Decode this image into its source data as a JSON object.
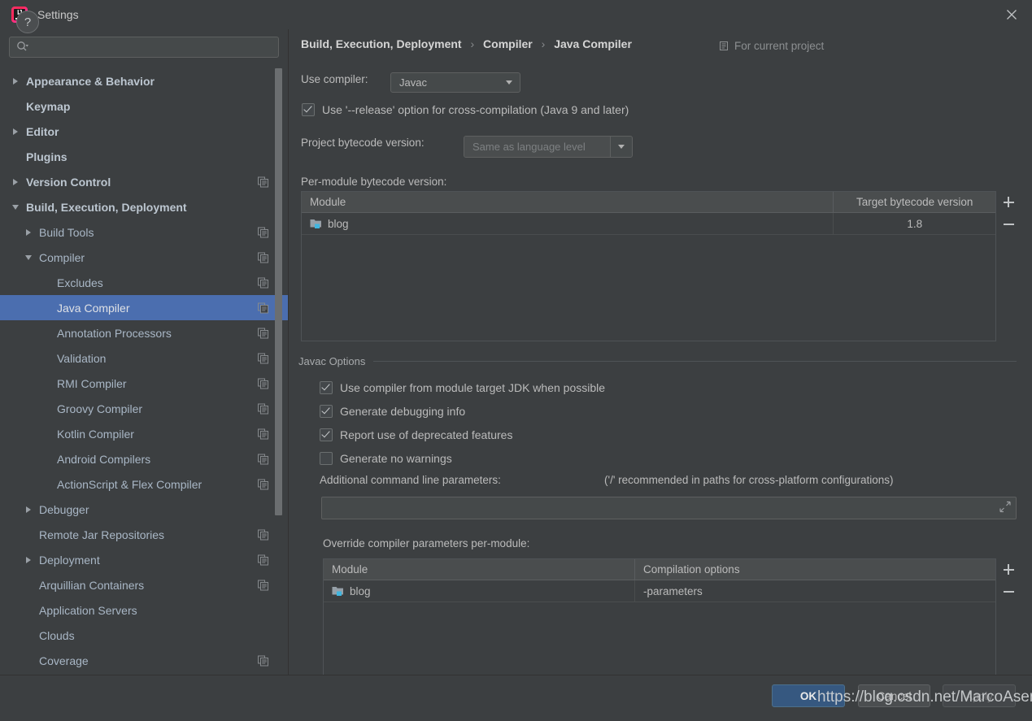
{
  "window": {
    "title": "Settings",
    "logo_icon": "intellij-idea-logo",
    "close_icon": "close-icon"
  },
  "search": {
    "placeholder": "",
    "value": "",
    "icon": "search-icon"
  },
  "sidebar": {
    "items": [
      {
        "label": "Appearance & Behavior",
        "arrow": "right",
        "indent": 0,
        "bold": true,
        "copy": false,
        "selected": false
      },
      {
        "label": "Keymap",
        "arrow": "none",
        "indent": 0,
        "bold": true,
        "copy": false,
        "selected": false
      },
      {
        "label": "Editor",
        "arrow": "right",
        "indent": 0,
        "bold": true,
        "copy": false,
        "selected": false
      },
      {
        "label": "Plugins",
        "arrow": "none",
        "indent": 0,
        "bold": true,
        "copy": false,
        "selected": false
      },
      {
        "label": "Version Control",
        "arrow": "right",
        "indent": 0,
        "bold": true,
        "copy": true,
        "selected": false
      },
      {
        "label": "Build, Execution, Deployment",
        "arrow": "down",
        "indent": 0,
        "bold": true,
        "copy": false,
        "selected": false
      },
      {
        "label": "Build Tools",
        "arrow": "right",
        "indent": 1,
        "bold": false,
        "copy": true,
        "selected": false
      },
      {
        "label": "Compiler",
        "arrow": "down",
        "indent": 1,
        "bold": false,
        "copy": true,
        "selected": false
      },
      {
        "label": "Excludes",
        "arrow": "none",
        "indent": 2,
        "bold": false,
        "copy": true,
        "selected": false
      },
      {
        "label": "Java Compiler",
        "arrow": "none",
        "indent": 2,
        "bold": false,
        "copy": true,
        "selected": true
      },
      {
        "label": "Annotation Processors",
        "arrow": "none",
        "indent": 2,
        "bold": false,
        "copy": true,
        "selected": false
      },
      {
        "label": "Validation",
        "arrow": "none",
        "indent": 2,
        "bold": false,
        "copy": true,
        "selected": false
      },
      {
        "label": "RMI Compiler",
        "arrow": "none",
        "indent": 2,
        "bold": false,
        "copy": true,
        "selected": false
      },
      {
        "label": "Groovy Compiler",
        "arrow": "none",
        "indent": 2,
        "bold": false,
        "copy": true,
        "selected": false
      },
      {
        "label": "Kotlin Compiler",
        "arrow": "none",
        "indent": 2,
        "bold": false,
        "copy": true,
        "selected": false
      },
      {
        "label": "Android Compilers",
        "arrow": "none",
        "indent": 2,
        "bold": false,
        "copy": true,
        "selected": false
      },
      {
        "label": "ActionScript & Flex Compiler",
        "arrow": "none",
        "indent": 2,
        "bold": false,
        "copy": true,
        "selected": false
      },
      {
        "label": "Debugger",
        "arrow": "right",
        "indent": 1,
        "bold": false,
        "copy": false,
        "selected": false
      },
      {
        "label": "Remote Jar Repositories",
        "arrow": "none",
        "indent": 1,
        "bold": false,
        "copy": true,
        "selected": false
      },
      {
        "label": "Deployment",
        "arrow": "right",
        "indent": 1,
        "bold": false,
        "copy": true,
        "selected": false
      },
      {
        "label": "Arquillian Containers",
        "arrow": "none",
        "indent": 1,
        "bold": false,
        "copy": true,
        "selected": false
      },
      {
        "label": "Application Servers",
        "arrow": "none",
        "indent": 1,
        "bold": false,
        "copy": false,
        "selected": false
      },
      {
        "label": "Clouds",
        "arrow": "none",
        "indent": 1,
        "bold": false,
        "copy": false,
        "selected": false
      },
      {
        "label": "Coverage",
        "arrow": "none",
        "indent": 1,
        "bold": false,
        "copy": true,
        "selected": false
      }
    ]
  },
  "main": {
    "breadcrumb": {
      "part1": "Build, Execution, Deployment",
      "part2": "Compiler",
      "part3": "Java Compiler",
      "separator": "›"
    },
    "for_current_project": {
      "label": "For current project",
      "icon": "project-scope-icon"
    },
    "use_compiler": {
      "label": "Use compiler:",
      "value": "Javac",
      "arrow_icon": "chevron-down-icon"
    },
    "release_option": {
      "label": "Use '--release' option for cross-compilation (Java 9 and later)",
      "checked": true
    },
    "project_bytecode": {
      "label": "Project bytecode version:",
      "value": "Same as language level",
      "arrow_icon": "chevron-down-icon"
    },
    "per_module_label": "Per-module bytecode version:",
    "module_table": {
      "columns": [
        "Module",
        "Target bytecode version"
      ],
      "rows": [
        {
          "module": "blog",
          "target": "1.8",
          "icon": "module-folder-icon"
        }
      ],
      "add_icon": "plus-icon",
      "remove_icon": "minus-icon"
    },
    "javac_options": {
      "title": "Javac Options",
      "checkboxes": [
        {
          "label": "Use compiler from module target JDK when possible",
          "checked": true
        },
        {
          "label": "Generate debugging info",
          "checked": true
        },
        {
          "label": "Report use of deprecated features",
          "checked": true
        },
        {
          "label": "Generate no warnings",
          "checked": false
        }
      ],
      "additional_params_label": "Additional command line parameters:",
      "additional_params_hint": "('/' recommended in paths for cross-platform configurations)",
      "additional_params_value": "",
      "expand_icon": "expand-icon"
    },
    "override_table": {
      "label": "Override compiler parameters per-module:",
      "columns": [
        "Module",
        "Compilation options"
      ],
      "rows": [
        {
          "module": "blog",
          "options": "-parameters",
          "icon": "module-folder-icon"
        }
      ],
      "add_icon": "plus-icon",
      "remove_icon": "minus-icon"
    }
  },
  "footer": {
    "help_label": "?",
    "ok_label": "OK",
    "cancel_label": "Cancel",
    "apply_label": "Apply"
  },
  "watermark": "https://blog.csdn.net/MarcoAsensio",
  "colors": {
    "background": "#3c3f41",
    "selection": "#4b6eaf",
    "primary_button": "#365880",
    "text": "#bbbbbb",
    "tree_text": "#a9b7c6",
    "module_icon_accent": "#40b6e0"
  }
}
